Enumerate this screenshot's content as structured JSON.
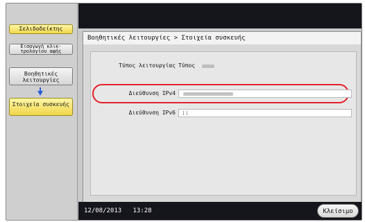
{
  "sidebar": {
    "bookmark_label": "Σελιδοδείκτης",
    "second_item_label": "Εισαγωγή κλικ- τρολογίου αφής",
    "help_functions_label": "Βοηθητικές λειτουργίες",
    "device_info_label": "Στοιχεία συσκευής",
    "arrow_icon": "arrow-down-icon"
  },
  "breadcrumb": "Βοηθητικές λειτουργίες > Στοιχεία συσκευής",
  "rows": [
    {
      "label": "Τύπος λειτουργίας",
      "value": "Τύπος"
    },
    {
      "label": "Διεύθυνση IPv4",
      "value": ""
    },
    {
      "label": "Διεύθυνση IPv6",
      "value": "::"
    }
  ],
  "footer": {
    "date": "12/08/2013",
    "time": "13:28",
    "close_label": "Κλείσιμο"
  },
  "colors": {
    "highlight": "#e4202a",
    "selected": "#f0d64a",
    "bar": "#15151c"
  }
}
